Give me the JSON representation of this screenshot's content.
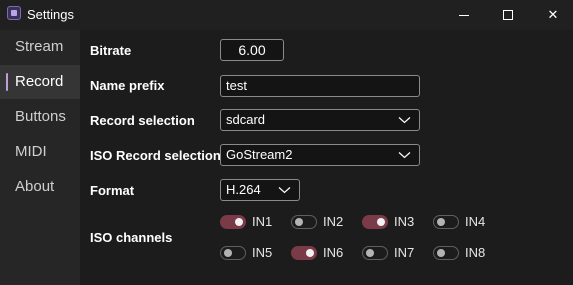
{
  "window": {
    "title": "Settings",
    "app_icon": "settings-app-icon",
    "controls": [
      "minimize-icon",
      "maximize-icon",
      "close-icon"
    ],
    "close_glyph": "✕"
  },
  "sidebar": {
    "items": [
      {
        "label": "Stream",
        "active": false
      },
      {
        "label": "Record",
        "active": true
      },
      {
        "label": "Buttons",
        "active": false
      },
      {
        "label": "MIDI",
        "active": false
      },
      {
        "label": "About",
        "active": false
      }
    ],
    "accent_color": "#c19dd9"
  },
  "form": {
    "bitrate": {
      "label": "Bitrate",
      "value": "6.00"
    },
    "name_prefix": {
      "label": "Name prefix",
      "value": "test"
    },
    "record_selection": {
      "label": "Record selection",
      "value": "sdcard"
    },
    "iso_record_selection": {
      "label": "ISO Record selection",
      "value": "GoStream2"
    },
    "format": {
      "label": "Format",
      "value": "H.264"
    },
    "iso_channels": {
      "label": "ISO channels",
      "channels": [
        {
          "name": "IN1",
          "enabled": true
        },
        {
          "name": "IN2",
          "enabled": false
        },
        {
          "name": "IN3",
          "enabled": true
        },
        {
          "name": "IN4",
          "enabled": false
        },
        {
          "name": "IN5",
          "enabled": false
        },
        {
          "name": "IN6",
          "enabled": true
        },
        {
          "name": "IN7",
          "enabled": false
        },
        {
          "name": "IN8",
          "enabled": false
        }
      ]
    }
  },
  "colors": {
    "toggle_on": "#7a3a47",
    "background": "#1c1c1c",
    "sidebar": "#262626"
  }
}
